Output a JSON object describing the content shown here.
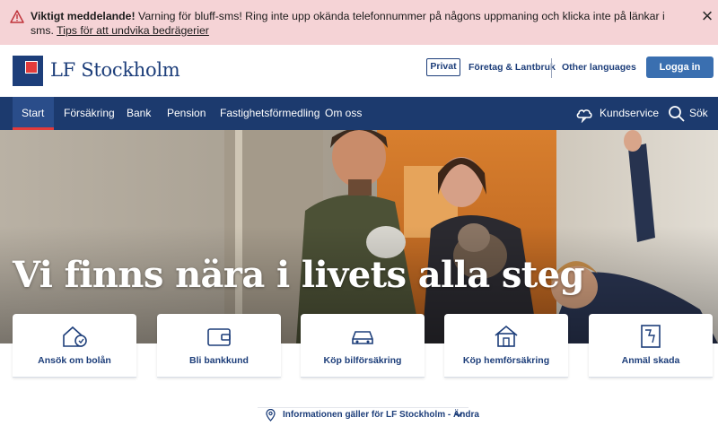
{
  "alert": {
    "bold": "Viktigt meddelande!",
    "text": " Varning för bluff-sms! Ring inte upp okända telefonnummer på någons uppmaning och klicka inte på länkar i sms. ",
    "link": "Tips för att undvika bedrägerier",
    "icon": "warning-triangle-icon",
    "close_icon": "close-icon",
    "close_glyph": "×"
  },
  "header": {
    "logo_text": "LF Stockholm",
    "segment_privat": "Privat",
    "segment_foretag": "Företag & Lantbruk",
    "other_languages": "Other languages",
    "login": "Logga in"
  },
  "nav": {
    "items": [
      "Start",
      "Försäkring",
      "Bank",
      "Pension",
      "Fastighetsförmedling",
      "Om oss"
    ],
    "kundservice": "Kundservice",
    "search": "Sök"
  },
  "hero": {
    "title": "Vi finns nära i livets alla steg"
  },
  "cards": [
    {
      "label": "Ansök om bolån",
      "icon": "house-mortgage-icon"
    },
    {
      "label": "Bli bankkund",
      "icon": "wallet-icon"
    },
    {
      "label": "Köp bilförsäkring",
      "icon": "car-icon"
    },
    {
      "label": "Köp hemförsäkring",
      "icon": "home-icon"
    },
    {
      "label": "Anmäl skada",
      "icon": "claim-document-icon"
    }
  ],
  "info": {
    "text": "Informationen gäller för LF Stockholm - Ändra"
  },
  "colors": {
    "navy": "#1c3a6e",
    "brand_blue": "#1d3e7a",
    "login_blue": "#3a6fb0",
    "alert_bg": "#f5d3d6",
    "accent_red": "#e23b3b"
  }
}
